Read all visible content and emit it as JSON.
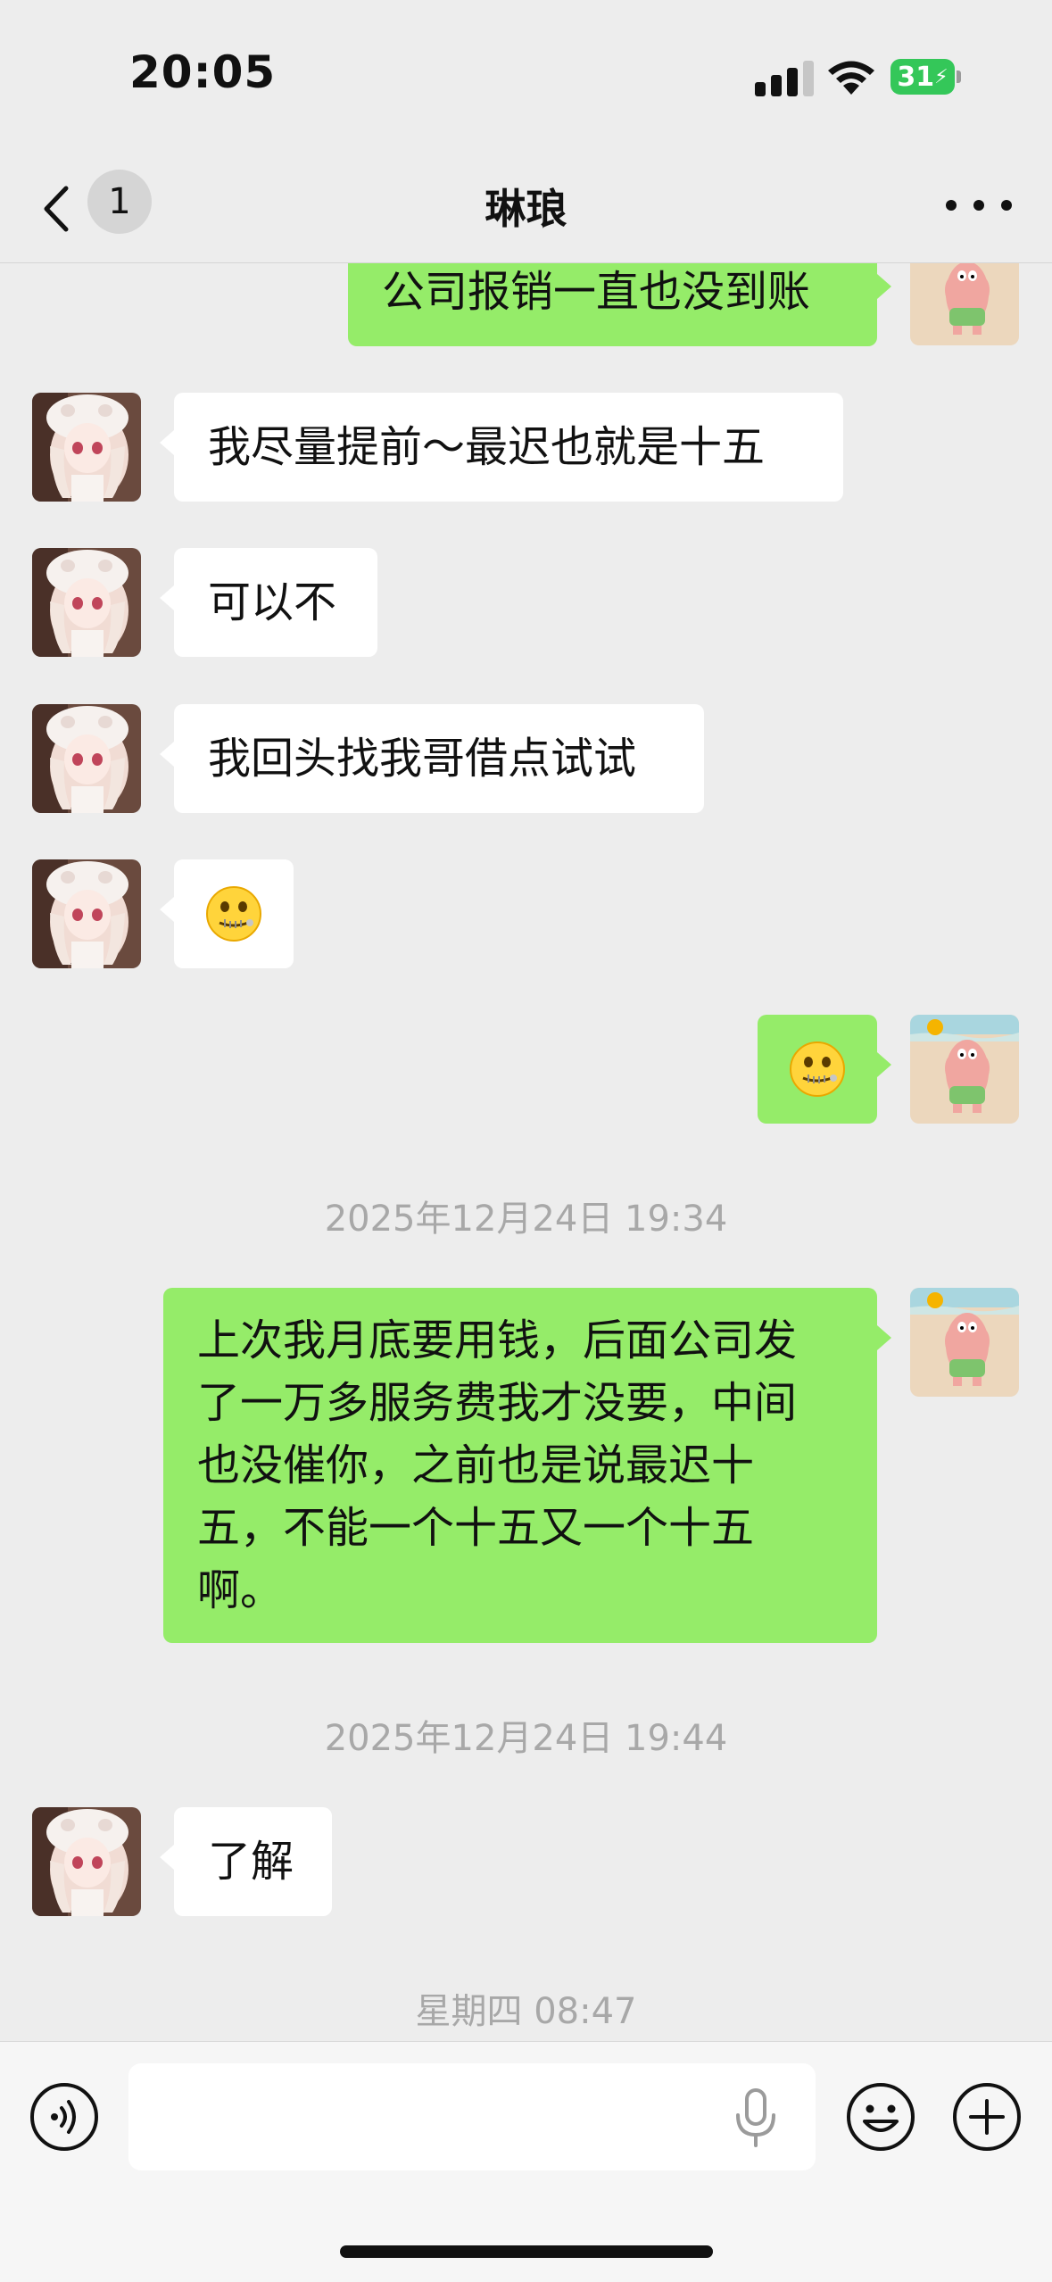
{
  "status_bar": {
    "time": "20:05",
    "battery": "31"
  },
  "nav": {
    "unread_count": "1",
    "title": "琳琅"
  },
  "messages": [
    {
      "side": "out",
      "type": "text",
      "text": "公司报销一直也没到账"
    },
    {
      "side": "in",
      "type": "text",
      "text": "我尽量提前～最迟也就是十五"
    },
    {
      "side": "in",
      "type": "text",
      "text": "可以不"
    },
    {
      "side": "in",
      "type": "text",
      "text": "我回头找我哥借点试试"
    },
    {
      "side": "in",
      "type": "emoji",
      "icon": "zipper-mouth-face-icon"
    },
    {
      "side": "out",
      "type": "emoji",
      "icon": "zipper-mouth-face-icon"
    },
    {
      "type": "timestamp",
      "text": "2025年12月24日 19:34"
    },
    {
      "side": "out",
      "type": "text",
      "lines": [
        "上次我月底要用钱，后面公司发",
        "了一万多服务费我才没要，中间",
        "也没催你，之前也是说最迟十",
        "五，不能一个十五又一个十五",
        "啊。"
      ]
    },
    {
      "type": "timestamp",
      "text": "2025年12月24日 19:44"
    },
    {
      "side": "in",
      "type": "text",
      "text": "了解"
    },
    {
      "type": "timestamp",
      "text": "星期四 08:47"
    }
  ],
  "input_bar": {
    "placeholder": ""
  },
  "colors": {
    "outgoing_bubble": "#95ec69",
    "incoming_bubble": "#ffffff",
    "background": "#ededed",
    "battery": "#34c759"
  }
}
